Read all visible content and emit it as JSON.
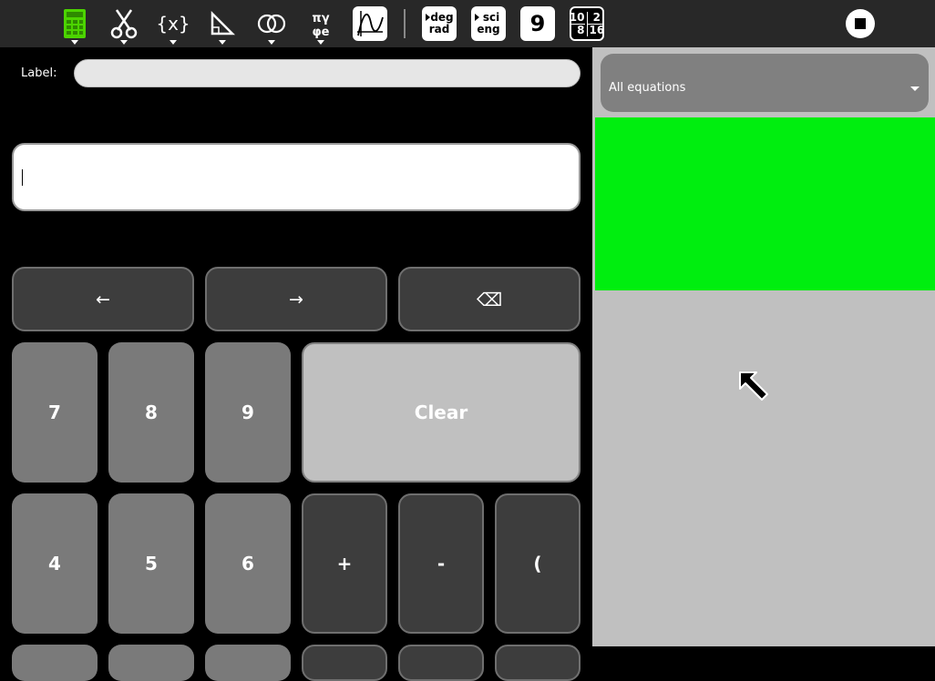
{
  "toolbar": {
    "icons": [
      "calculator-icon",
      "scissors-icon",
      "variables-icon",
      "trigonometry-icon",
      "boolean-icon",
      "constants-icon",
      "plot-icon"
    ],
    "angle_mode": {
      "line1": "deg",
      "line2": "rad"
    },
    "notation_mode": {
      "line1": "sci",
      "line2": "eng"
    },
    "digits": "9",
    "base": {
      "top": "10",
      "top_right": "2",
      "bottom_left": "8",
      "bottom_right": "16"
    },
    "stop_icon": "stop-icon"
  },
  "calc": {
    "label_caption": "Label:",
    "label_value": "",
    "expression": "",
    "keys": {
      "left": "←",
      "right": "→",
      "backspace": "⌫",
      "seven": "7",
      "eight": "8",
      "nine": "9",
      "clear": "Clear",
      "four": "4",
      "five": "5",
      "six": "6",
      "plus": "+",
      "minus": "-",
      "open_paren": "("
    }
  },
  "history": {
    "filter_label": "All equations"
  },
  "colors": {
    "graph_bg": "#00ee0f",
    "panel_bg": "#c0c0c0",
    "calc_icon": "#4cd400"
  }
}
